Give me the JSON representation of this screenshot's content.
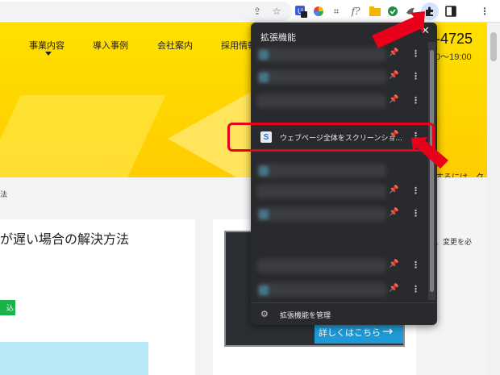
{
  "browser": {
    "toolbar_icons": [
      "share-icon",
      "star-icon",
      "extension-badge-icon",
      "color-wheel-icon",
      "crop-icon",
      "formula-icon",
      "folder-icon",
      "shield-icon",
      "bird-icon",
      "puzzle-icon",
      "sidebar-icon",
      "more-icon"
    ],
    "formula_glyph": "f?",
    "badge_count": "1"
  },
  "site": {
    "nav": [
      "事業内容",
      "導入事例",
      "会社案内",
      "採用情報"
    ],
    "phone": "-4725",
    "hours": "0～19:00",
    "hero_snippet": "するには、ク",
    "right_snippet": "、変更を必",
    "breadcrumb": "法",
    "article_title": "が遅い場合の解決方法",
    "green_button": "込",
    "banner_cta": "詳しくはこちら",
    "banner_arrow": "→"
  },
  "extensions_popup": {
    "title": "拡張機能",
    "close_glyph": "✕",
    "rows": [
      {
        "label": "",
        "pinned": true
      },
      {
        "label": "",
        "pinned": true
      },
      {
        "label": "",
        "pinned": true
      },
      {
        "label": "ウェブページ全体をスクリーンショ...",
        "pinned": false,
        "icon": "S"
      },
      {
        "label": "",
        "pinned": true
      },
      {
        "label": "",
        "pinned": true
      },
      {
        "label": "",
        "pinned": true
      },
      {
        "label": "",
        "pinned": false
      },
      {
        "label": "",
        "pinned": false
      }
    ],
    "manage_label": "拡張機能を管理"
  },
  "colors": {
    "hero": "#ffd400",
    "popup_bg": "#292a2d",
    "annotation": "#e8001b",
    "pin_active": "#8ab4f8"
  }
}
